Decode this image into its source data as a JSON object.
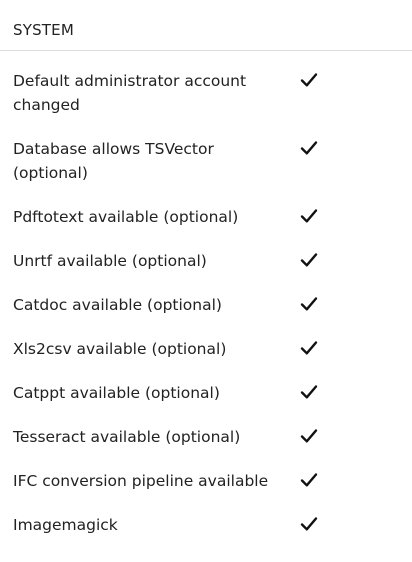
{
  "section": {
    "title": "SYSTEM"
  },
  "items": [
    {
      "label": "Default administrator account changed",
      "status": "ok",
      "icon": "checkmark-icon"
    },
    {
      "label": "Database allows TSVector (optional)",
      "status": "ok",
      "icon": "checkmark-icon"
    },
    {
      "label": "Pdftotext available (optional)",
      "status": "ok",
      "icon": "checkmark-icon"
    },
    {
      "label": "Unrtf available (optional)",
      "status": "ok",
      "icon": "checkmark-icon"
    },
    {
      "label": "Catdoc available (optional)",
      "status": "ok",
      "icon": "checkmark-icon"
    },
    {
      "label": "Xls2csv available (optional)",
      "status": "ok",
      "icon": "checkmark-icon"
    },
    {
      "label": "Catppt available (optional)",
      "status": "ok",
      "icon": "checkmark-icon"
    },
    {
      "label": "Tesseract available (optional)",
      "status": "ok",
      "icon": "checkmark-icon"
    },
    {
      "label": "IFC conversion pipeline available",
      "status": "ok",
      "icon": "checkmark-icon"
    },
    {
      "label": "Imagemagick",
      "status": "ok",
      "icon": "checkmark-icon"
    }
  ],
  "colors": {
    "text": "#222222",
    "divider": "#dcdcdc",
    "check": "#111111"
  }
}
